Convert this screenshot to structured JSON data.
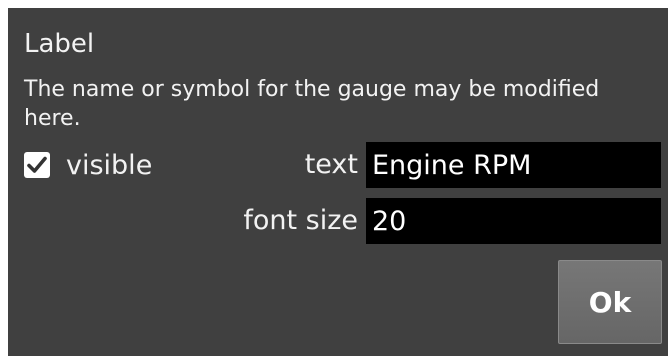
{
  "dialog": {
    "title": "Label",
    "description": "The name or symbol for the gauge may be modified here.",
    "visible": {
      "label": "visible",
      "checked": true,
      "icon": "checkmark-icon"
    },
    "fields": {
      "text": {
        "label": "text",
        "value": "Engine RPM"
      },
      "font_size": {
        "label": "font size",
        "value": "20"
      }
    },
    "ok_label": "Ok"
  },
  "colors": {
    "dialog_background": "#404040",
    "input_background": "#000000",
    "text": "#ffffff",
    "button_background": "#6e6e6e"
  }
}
